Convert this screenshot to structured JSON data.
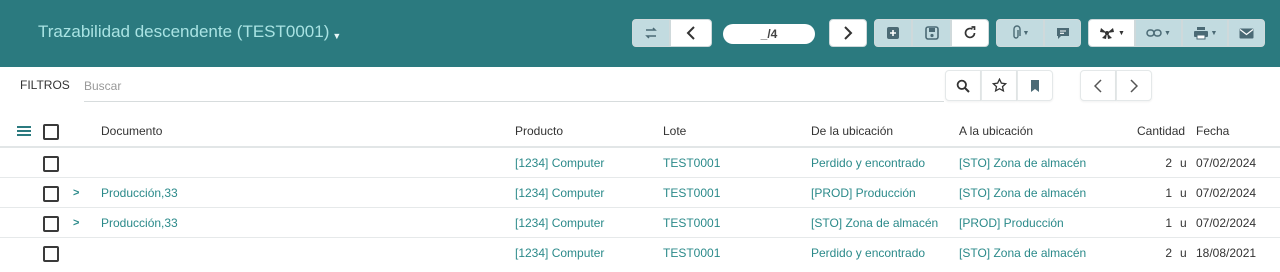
{
  "header": {
    "title": "Trazabilidad descendente (TEST0001)",
    "pager": "_/4"
  },
  "icons": {
    "swap": "swap-arrows-icon",
    "prev": "chevron-left-icon",
    "next": "chevron-right-icon",
    "new": "plus-square-icon",
    "save": "floppy-disk-icon",
    "reload": "refresh-icon",
    "attach": "paperclip-icon",
    "message": "chat-bubble-icon",
    "action": "gear-icon",
    "link": "link-icon",
    "print": "printer-icon",
    "email": "envelope-icon",
    "search": "magnifier-icon",
    "favorite": "star-icon",
    "bookmark": "bookmark-icon",
    "list_menu": "hamburger-menu-icon"
  },
  "filter": {
    "label": "FILTROS",
    "placeholder": "Buscar"
  },
  "table": {
    "columns": {
      "documento": "Documento",
      "producto": "Producto",
      "lote": "Lote",
      "de": "De la ubicación",
      "a": "A la ubicación",
      "cantidad": "Cantidad",
      "fecha": "Fecha"
    },
    "rows": [
      {
        "documento": "",
        "producto": "[1234] Computer",
        "lote": "TEST0001",
        "de": "Perdido y encontrado",
        "a": "[STO] Zona de almacén",
        "cantidad": "2",
        "unidad": "u",
        "fecha": "07/02/2024"
      },
      {
        "documento": "Producción,33",
        "producto": "[1234] Computer",
        "lote": "TEST0001",
        "de": "[PROD] Producción",
        "a": "[STO] Zona de almacén",
        "cantidad": "1",
        "unidad": "u",
        "fecha": "07/02/2024"
      },
      {
        "documento": "Producción,33",
        "producto": "[1234] Computer",
        "lote": "TEST0001",
        "de": "[STO] Zona de almacén",
        "a": "[PROD] Producción",
        "cantidad": "1",
        "unidad": "u",
        "fecha": "07/02/2024"
      },
      {
        "documento": "",
        "producto": "[1234] Computer",
        "lote": "TEST0001",
        "de": "Perdido y encontrado",
        "a": "[STO] Zona de almacén",
        "cantidad": "2",
        "unidad": "u",
        "fecha": "18/08/2021"
      }
    ]
  },
  "colors": {
    "header_bg": "#2b7a7f",
    "title": "#a9e3e3",
    "link": "#2b8a8a"
  }
}
